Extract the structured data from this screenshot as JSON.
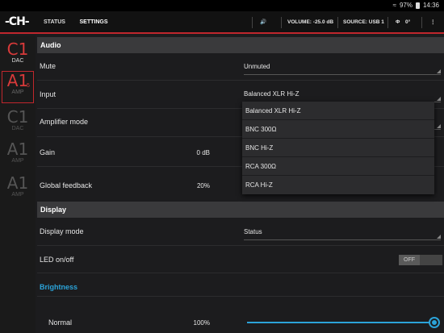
{
  "statusbar": {
    "battery": "97%",
    "time": "14:36"
  },
  "appbar": {
    "logo": "-CH-",
    "tabs": [
      "STATUS",
      "SETTINGS"
    ],
    "volume": "VOLUME: -25.0 dB",
    "source": "SOURCE: USB 1",
    "phase": "0°"
  },
  "sidebar": [
    {
      "big": "C1",
      "small": "DAC"
    },
    {
      "big": "A1",
      "sub": "5",
      "small": "AMP"
    },
    {
      "big": "C1",
      "small": "DAC"
    },
    {
      "big": "A1",
      "small": "AMP"
    },
    {
      "big": "A1",
      "small": "AMP"
    }
  ],
  "audio": {
    "title": "Audio",
    "mute_label": "Mute",
    "mute_value": "Unmuted",
    "input_label": "Input",
    "input_value": "Balanced XLR Hi-Z",
    "amp_label": "Amplifier mode",
    "gain_label": "Gain",
    "gain_value": "0 dB",
    "feedback_label": "Global feedback",
    "feedback_value": "20%"
  },
  "input_options": [
    "Balanced XLR Hi-Z",
    "BNC 300Ω",
    "BNC Hi-Z",
    "RCA 300Ω",
    "RCA Hi-Z"
  ],
  "display": {
    "title": "Display",
    "mode_label": "Display mode",
    "mode_value": "Status",
    "led_label": "LED on/off",
    "led_value": "OFF",
    "brightness_title": "Brightness",
    "normal_label": "Normal",
    "normal_value": "100%",
    "normal_level": 1.0
  },
  "colors": {
    "accent": "#2ba3d9",
    "brand": "#c0272d"
  }
}
